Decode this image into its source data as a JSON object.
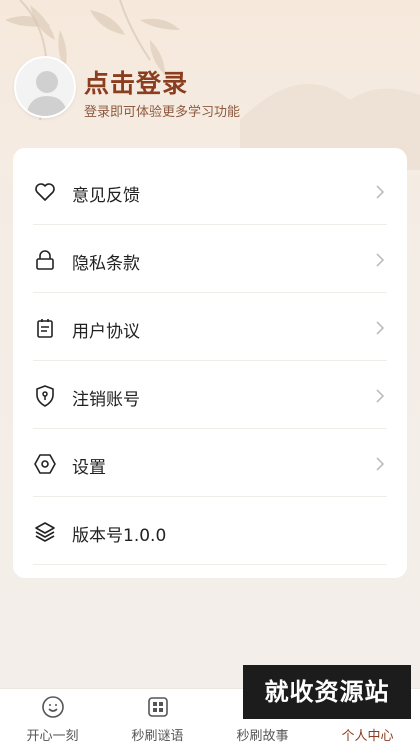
{
  "profile": {
    "title": "点击登录",
    "subtitle": "登录即可体验更多学习功能"
  },
  "menu": [
    {
      "label": "意见反馈",
      "icon": "heart-icon"
    },
    {
      "label": "隐私条款",
      "icon": "lock-icon"
    },
    {
      "label": "用户协议",
      "icon": "clipboard-icon"
    },
    {
      "label": "注销账号",
      "icon": "shield-icon"
    },
    {
      "label": "设置",
      "icon": "hexagon-settings-icon"
    },
    {
      "label": "版本号1.0.0",
      "icon": "layers-icon"
    }
  ],
  "tabs": [
    {
      "label": "开心一刻",
      "icon": "smile-icon"
    },
    {
      "label": "秒刷谜语",
      "icon": "grid-icon"
    },
    {
      "label": "秒刷故事",
      "icon": "book-icon"
    },
    {
      "label": "个人中心",
      "icon": "user-icon",
      "active": true
    }
  ],
  "watermark": "就收资源站",
  "colors": {
    "accent": "#8b3d1f",
    "subtitle": "#8d5a3f",
    "background": "#f4ede6"
  }
}
